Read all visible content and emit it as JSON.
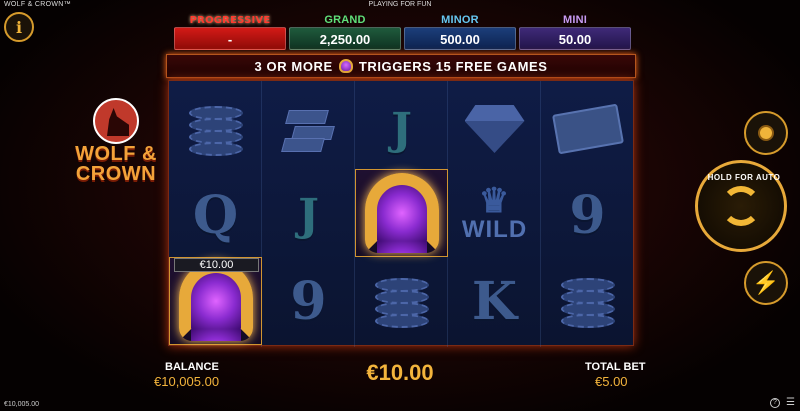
{
  "window": {
    "title": "WOLF & CROWN™",
    "mode": "PLAYING FOR FUN"
  },
  "jackpots": {
    "progressive": {
      "label": "PROGRESSIVE",
      "value": "-"
    },
    "grand": {
      "label": "GRAND",
      "value": "2,250.00"
    },
    "minor": {
      "label": "MINOR",
      "value": "500.00"
    },
    "mini": {
      "label": "MINI",
      "value": "50.00"
    }
  },
  "banner": {
    "left": "3 OR MORE",
    "right": "TRIGGERS 15 FREE GAMES"
  },
  "logo": {
    "line1": "WOLF &",
    "line2": "CROWN"
  },
  "reels": [
    [
      "chips",
      "Q",
      "horseshoe"
    ],
    [
      "gold-bars",
      "J",
      "9"
    ],
    [
      "J",
      "horseshoe",
      "chips"
    ],
    [
      "diamond",
      "WILD",
      "K"
    ],
    [
      "cash",
      "9",
      "chips"
    ]
  ],
  "wild_label": "WILD",
  "coin_value": "€10.00",
  "controls": {
    "hold_for_auto": "HOLD FOR AUTO"
  },
  "footer": {
    "balance_label": "BALANCE",
    "balance_value": "€10,005.00",
    "win_value": "€10.00",
    "total_bet_label": "TOTAL BET",
    "total_bet_value": "€5.00",
    "small_balance": "€10,005.00"
  },
  "colors": {
    "accent": "#f3b43c",
    "progressive": "#d31a16",
    "grand": "#1f5a3c",
    "minor": "#1c3e7a",
    "mini": "#3f2a78"
  }
}
